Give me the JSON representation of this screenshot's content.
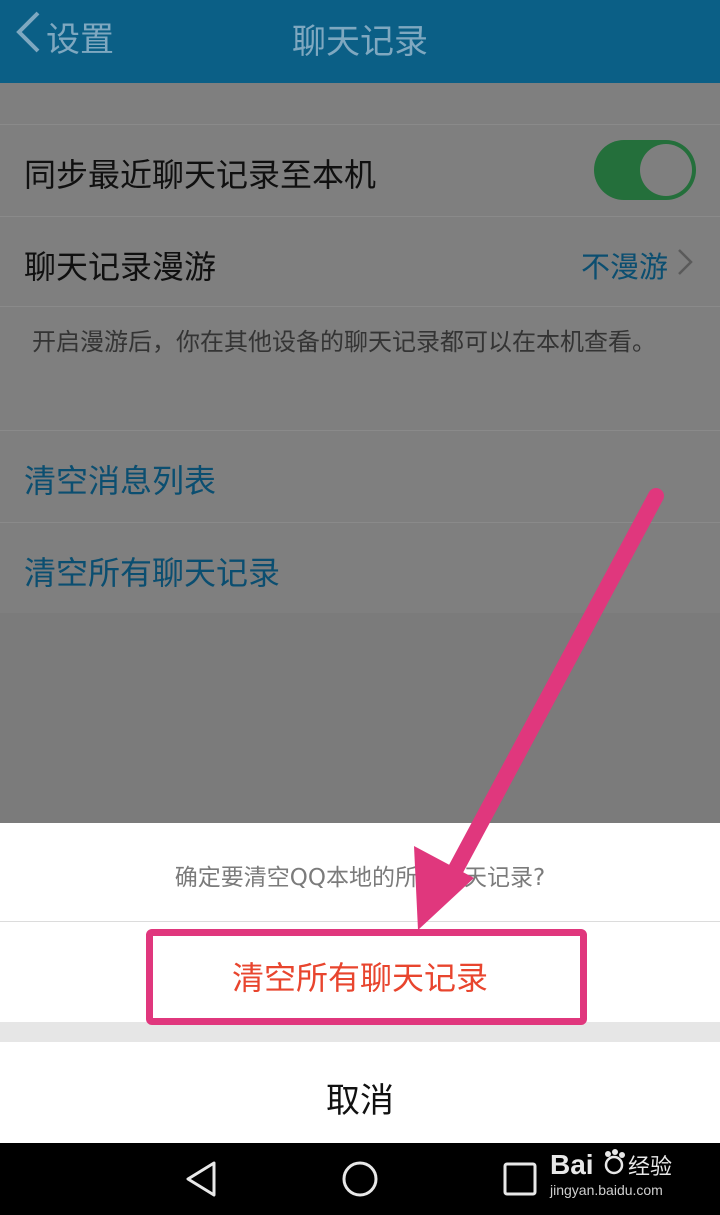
{
  "header": {
    "back_label": "设置",
    "title": "聊天记录"
  },
  "settings": {
    "sync_label": "同步最近聊天记录至本机",
    "sync_enabled": true,
    "roaming_label": "聊天记录漫游",
    "roaming_value": "不漫游",
    "hint": "开启漫游后，你在其他设备的聊天记录都可以在本机查看。",
    "clear_list_label": "清空消息列表",
    "clear_all_label": "清空所有聊天记录"
  },
  "sheet": {
    "prompt": "确定要清空QQ本地的所有聊天记录?",
    "confirm_label": "清空所有聊天记录",
    "cancel_label": "取消"
  },
  "navbar": {
    "icons": [
      "back-triangle-icon",
      "home-circle-icon",
      "recents-square-icon"
    ]
  },
  "watermark": {
    "brand": "Bai",
    "brand_suffix": "经验",
    "url": "jingyan.baidu.com"
  },
  "colors": {
    "titlebar": "#0b5f86",
    "accent_link": "#0b4e70",
    "toggle_on": "#246f3b",
    "danger": "#e8452e",
    "annotation": "#e0377d"
  }
}
